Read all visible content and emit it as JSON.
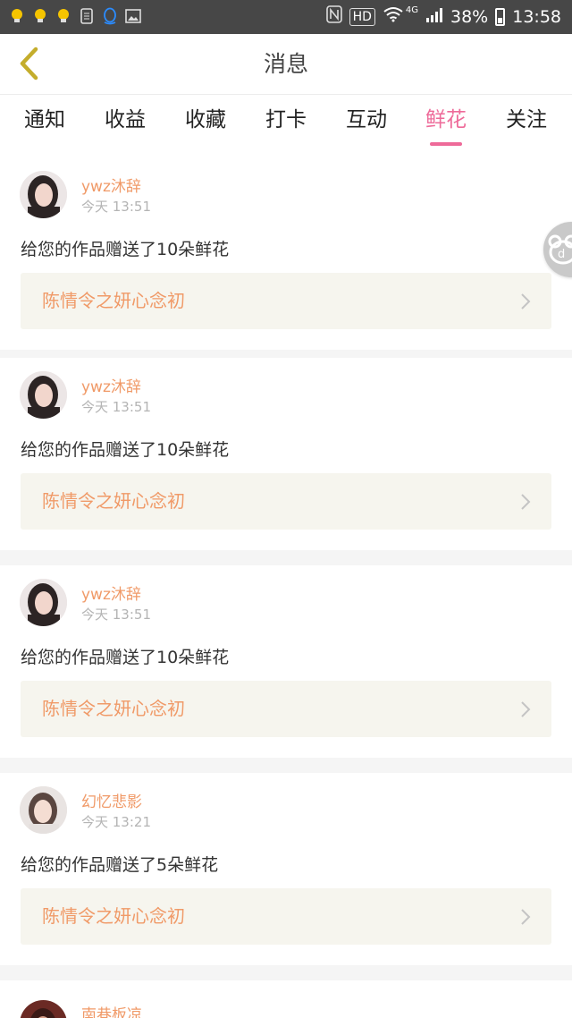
{
  "status_bar": {
    "hd": "HD",
    "network": "4G",
    "battery": "38%",
    "time": "13:58"
  },
  "header": {
    "title": "消息"
  },
  "tabs": [
    {
      "label": "通知",
      "active": false
    },
    {
      "label": "收益",
      "active": false
    },
    {
      "label": "收藏",
      "active": false
    },
    {
      "label": "打卡",
      "active": false
    },
    {
      "label": "互动",
      "active": false
    },
    {
      "label": "鲜花",
      "active": true
    },
    {
      "label": "关注",
      "active": false
    }
  ],
  "messages": [
    {
      "user": "ywz沐辞",
      "time": "今天 13:51",
      "text": "给您的作品赠送了10朵鲜花",
      "work": "陈情令之妍心念初"
    },
    {
      "user": "ywz沐辞",
      "time": "今天 13:51",
      "text": "给您的作品赠送了10朵鲜花",
      "work": "陈情令之妍心念初"
    },
    {
      "user": "ywz沐辞",
      "time": "今天 13:51",
      "text": "给您的作品赠送了10朵鲜花",
      "work": "陈情令之妍心念初"
    },
    {
      "user": "幻忆悲影",
      "time": "今天 13:21",
      "text": "给您的作品赠送了5朵鲜花",
      "work": "陈情令之妍心念初"
    },
    {
      "user": "南巷板凉"
    }
  ],
  "colors": {
    "accent": "#ee6a99",
    "name": "#f09a68",
    "work_bg": "#f6f5ee",
    "status_bar_bg": "#474747"
  }
}
